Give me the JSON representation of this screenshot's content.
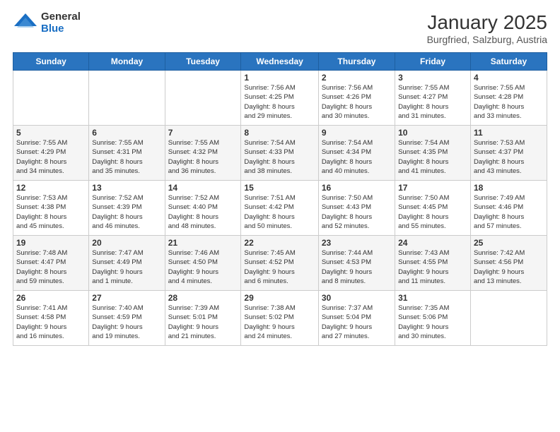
{
  "header": {
    "logo_general": "General",
    "logo_blue": "Blue",
    "month_title": "January 2025",
    "location": "Burgfried, Salzburg, Austria"
  },
  "days_of_week": [
    "Sunday",
    "Monday",
    "Tuesday",
    "Wednesday",
    "Thursday",
    "Friday",
    "Saturday"
  ],
  "weeks": [
    [
      {
        "day": "",
        "info": ""
      },
      {
        "day": "",
        "info": ""
      },
      {
        "day": "",
        "info": ""
      },
      {
        "day": "1",
        "info": "Sunrise: 7:56 AM\nSunset: 4:25 PM\nDaylight: 8 hours\nand 29 minutes."
      },
      {
        "day": "2",
        "info": "Sunrise: 7:56 AM\nSunset: 4:26 PM\nDaylight: 8 hours\nand 30 minutes."
      },
      {
        "day": "3",
        "info": "Sunrise: 7:55 AM\nSunset: 4:27 PM\nDaylight: 8 hours\nand 31 minutes."
      },
      {
        "day": "4",
        "info": "Sunrise: 7:55 AM\nSunset: 4:28 PM\nDaylight: 8 hours\nand 33 minutes."
      }
    ],
    [
      {
        "day": "5",
        "info": "Sunrise: 7:55 AM\nSunset: 4:29 PM\nDaylight: 8 hours\nand 34 minutes."
      },
      {
        "day": "6",
        "info": "Sunrise: 7:55 AM\nSunset: 4:31 PM\nDaylight: 8 hours\nand 35 minutes."
      },
      {
        "day": "7",
        "info": "Sunrise: 7:55 AM\nSunset: 4:32 PM\nDaylight: 8 hours\nand 36 minutes."
      },
      {
        "day": "8",
        "info": "Sunrise: 7:54 AM\nSunset: 4:33 PM\nDaylight: 8 hours\nand 38 minutes."
      },
      {
        "day": "9",
        "info": "Sunrise: 7:54 AM\nSunset: 4:34 PM\nDaylight: 8 hours\nand 40 minutes."
      },
      {
        "day": "10",
        "info": "Sunrise: 7:54 AM\nSunset: 4:35 PM\nDaylight: 8 hours\nand 41 minutes."
      },
      {
        "day": "11",
        "info": "Sunrise: 7:53 AM\nSunset: 4:37 PM\nDaylight: 8 hours\nand 43 minutes."
      }
    ],
    [
      {
        "day": "12",
        "info": "Sunrise: 7:53 AM\nSunset: 4:38 PM\nDaylight: 8 hours\nand 45 minutes."
      },
      {
        "day": "13",
        "info": "Sunrise: 7:52 AM\nSunset: 4:39 PM\nDaylight: 8 hours\nand 46 minutes."
      },
      {
        "day": "14",
        "info": "Sunrise: 7:52 AM\nSunset: 4:40 PM\nDaylight: 8 hours\nand 48 minutes."
      },
      {
        "day": "15",
        "info": "Sunrise: 7:51 AM\nSunset: 4:42 PM\nDaylight: 8 hours\nand 50 minutes."
      },
      {
        "day": "16",
        "info": "Sunrise: 7:50 AM\nSunset: 4:43 PM\nDaylight: 8 hours\nand 52 minutes."
      },
      {
        "day": "17",
        "info": "Sunrise: 7:50 AM\nSunset: 4:45 PM\nDaylight: 8 hours\nand 55 minutes."
      },
      {
        "day": "18",
        "info": "Sunrise: 7:49 AM\nSunset: 4:46 PM\nDaylight: 8 hours\nand 57 minutes."
      }
    ],
    [
      {
        "day": "19",
        "info": "Sunrise: 7:48 AM\nSunset: 4:47 PM\nDaylight: 8 hours\nand 59 minutes."
      },
      {
        "day": "20",
        "info": "Sunrise: 7:47 AM\nSunset: 4:49 PM\nDaylight: 9 hours\nand 1 minute."
      },
      {
        "day": "21",
        "info": "Sunrise: 7:46 AM\nSunset: 4:50 PM\nDaylight: 9 hours\nand 4 minutes."
      },
      {
        "day": "22",
        "info": "Sunrise: 7:45 AM\nSunset: 4:52 PM\nDaylight: 9 hours\nand 6 minutes."
      },
      {
        "day": "23",
        "info": "Sunrise: 7:44 AM\nSunset: 4:53 PM\nDaylight: 9 hours\nand 8 minutes."
      },
      {
        "day": "24",
        "info": "Sunrise: 7:43 AM\nSunset: 4:55 PM\nDaylight: 9 hours\nand 11 minutes."
      },
      {
        "day": "25",
        "info": "Sunrise: 7:42 AM\nSunset: 4:56 PM\nDaylight: 9 hours\nand 13 minutes."
      }
    ],
    [
      {
        "day": "26",
        "info": "Sunrise: 7:41 AM\nSunset: 4:58 PM\nDaylight: 9 hours\nand 16 minutes."
      },
      {
        "day": "27",
        "info": "Sunrise: 7:40 AM\nSunset: 4:59 PM\nDaylight: 9 hours\nand 19 minutes."
      },
      {
        "day": "28",
        "info": "Sunrise: 7:39 AM\nSunset: 5:01 PM\nDaylight: 9 hours\nand 21 minutes."
      },
      {
        "day": "29",
        "info": "Sunrise: 7:38 AM\nSunset: 5:02 PM\nDaylight: 9 hours\nand 24 minutes."
      },
      {
        "day": "30",
        "info": "Sunrise: 7:37 AM\nSunset: 5:04 PM\nDaylight: 9 hours\nand 27 minutes."
      },
      {
        "day": "31",
        "info": "Sunrise: 7:35 AM\nSunset: 5:06 PM\nDaylight: 9 hours\nand 30 minutes."
      },
      {
        "day": "",
        "info": ""
      }
    ]
  ]
}
